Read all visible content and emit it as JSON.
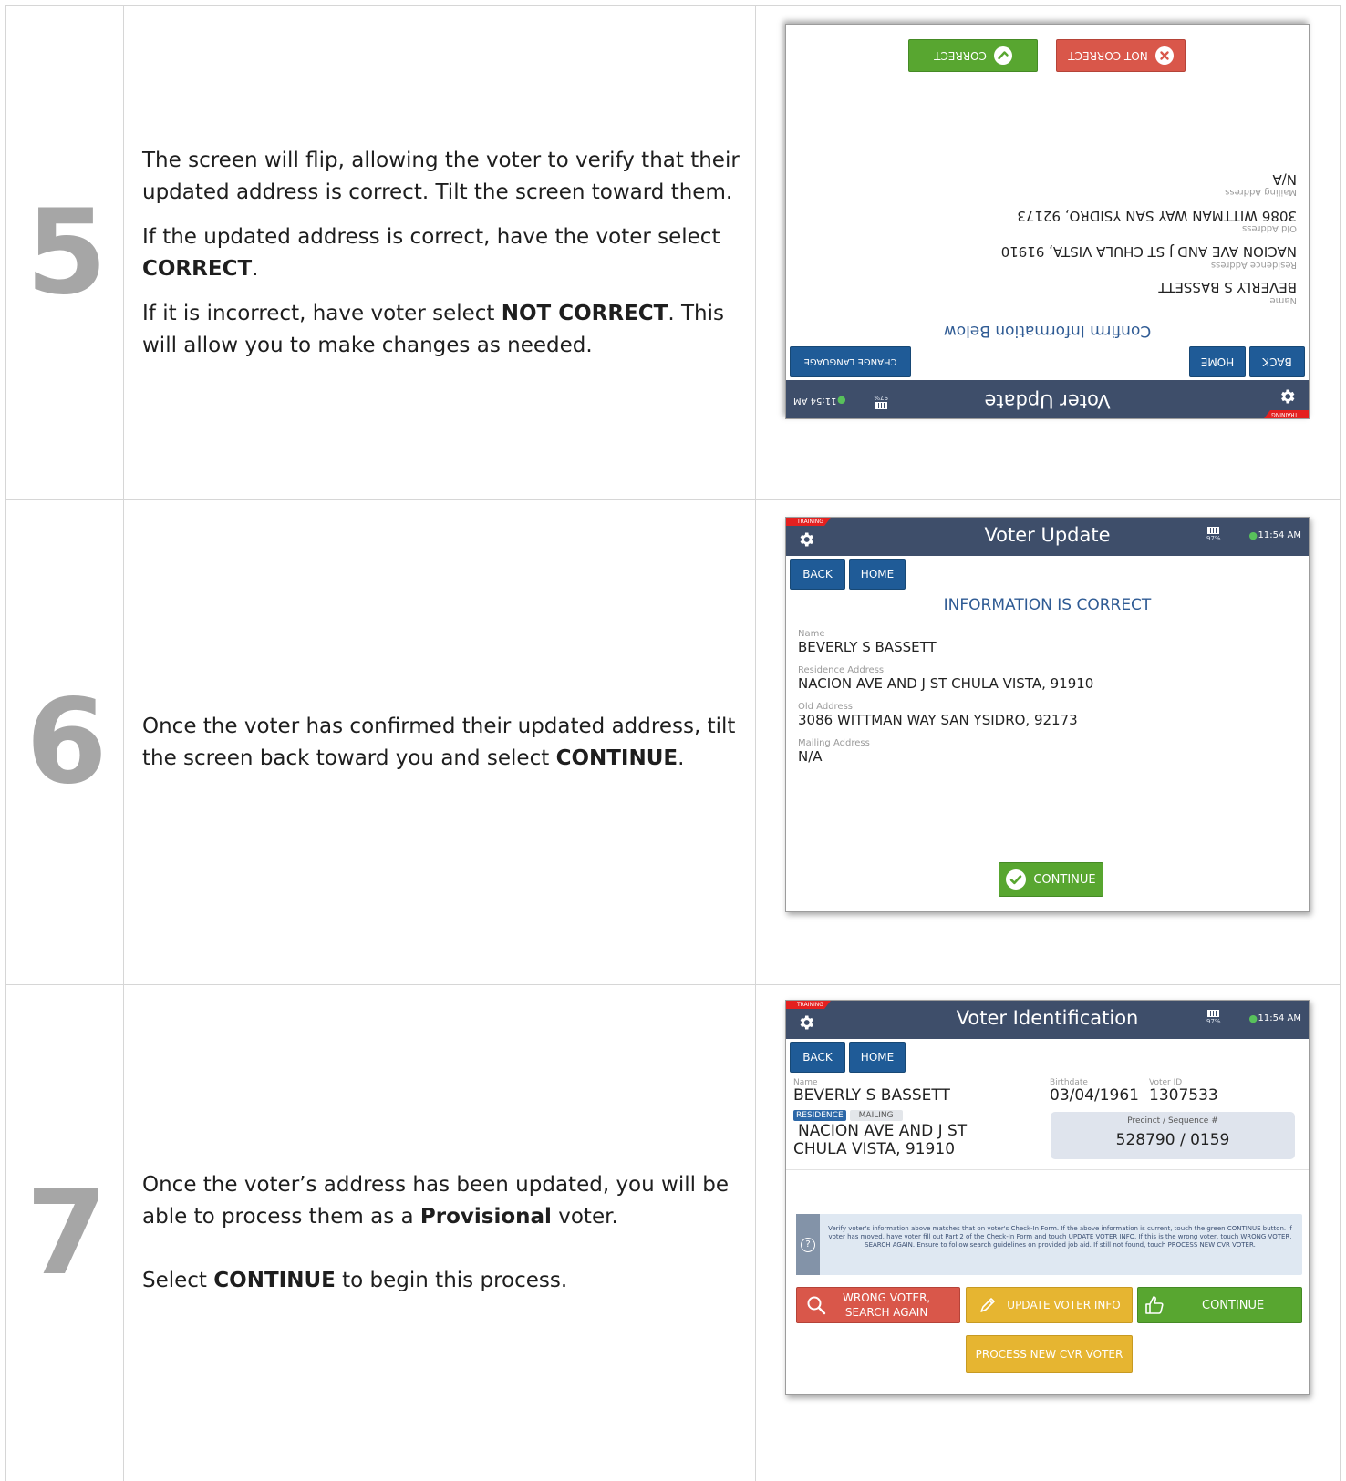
{
  "steps": [
    {
      "number": "5",
      "paragraphs": [
        {
          "text": "The screen will flip, allowing the voter to verify that their updated address is correct. Tilt the screen toward them."
        },
        {
          "before": "If the updated address is correct, have the voter select ",
          "bold": "CORRECT",
          "after": "."
        },
        {
          "before": "If it is incorrect, have voter select ",
          "bold": "NOT CORRECT",
          "after": ". This will allow you to make changes as needed."
        }
      ]
    },
    {
      "number": "6",
      "paragraphs": [
        {
          "before": "Once the voter has confirmed their updated address, tilt the screen back toward you and select ",
          "bold": "CONTINUE",
          "after": "."
        }
      ]
    },
    {
      "number": "7",
      "paragraphs": [
        {
          "before": "Once the voter’s address has been updated, you will be able to process them as a ",
          "bold": "Provisional",
          "after": " voter."
        },
        {
          "before": "Select ",
          "bold": "CONTINUE",
          "after": " to begin this process."
        }
      ]
    }
  ],
  "screen_common": {
    "training_tag": "TRAINING",
    "battery": "97%",
    "time": "11:54 AM",
    "back": "BACK",
    "home": "HOME"
  },
  "screen5": {
    "title": "Voter Update",
    "change_language": "CHANGE LANGUAGE",
    "heading": "Confirm Information Below",
    "name_label": "Name",
    "name": "BEVERLY S BASSETT",
    "residence_label": "Residence Address",
    "residence": "NACION AVE AND J ST CHULA VISTA, 91910",
    "old_label": "Old Address",
    "old": "3086 WITTMAN WAY SAN YSIDRO, 92173",
    "mailing_label": "Mailing Address",
    "mailing": "N/A",
    "correct": "CORRECT",
    "not_correct": "NOT CORRECT"
  },
  "screen6": {
    "title": "Voter Update",
    "heading": "INFORMATION IS CORRECT",
    "name_label": "Name",
    "name": "BEVERLY S BASSETT",
    "residence_label": "Residence Address",
    "residence": "NACION AVE AND J ST CHULA VISTA, 91910",
    "old_label": "Old Address",
    "old": "3086 WITTMAN WAY SAN YSIDRO, 92173",
    "mailing_label": "Mailing Address",
    "mailing": "N/A",
    "continue": "CONTINUE"
  },
  "screen7": {
    "title": "Voter Identification",
    "name_label": "Name",
    "name": "BEVERLY S BASSETT",
    "birthdate_label": "Birthdate",
    "birthdate": "03/04/1961",
    "voter_id_label": "Voter ID",
    "voter_id": "1307533",
    "tab_residence": "RESIDENCE",
    "tab_mailing": "MAILING",
    "address_line1": "NACION AVE AND J ST",
    "address_line2": "CHULA VISTA, 91910",
    "precinct_label": "Precinct / Sequence #",
    "precinct": "528790 / 0159",
    "help_text": "Verify voter's information above matches that on voter's Check-In Form. If the above information is current, touch the green CONTINUE button. If voter has moved, have voter fill out Part 2 of the Check-In Form and touch UPDATE VOTER INFO. If this is the wrong voter, touch WRONG VOTER, SEARCH AGAIN. Ensure to follow search guidelines on provided job aid. If still not found, touch PROCESS NEW CVR VOTER.",
    "wrong_voter_line1": "WRONG VOTER,",
    "wrong_voter_line2": "SEARCH AGAIN",
    "update_voter": "UPDATE VOTER INFO",
    "continue": "CONTINUE",
    "process_new": "PROCESS NEW CVR VOTER"
  }
}
